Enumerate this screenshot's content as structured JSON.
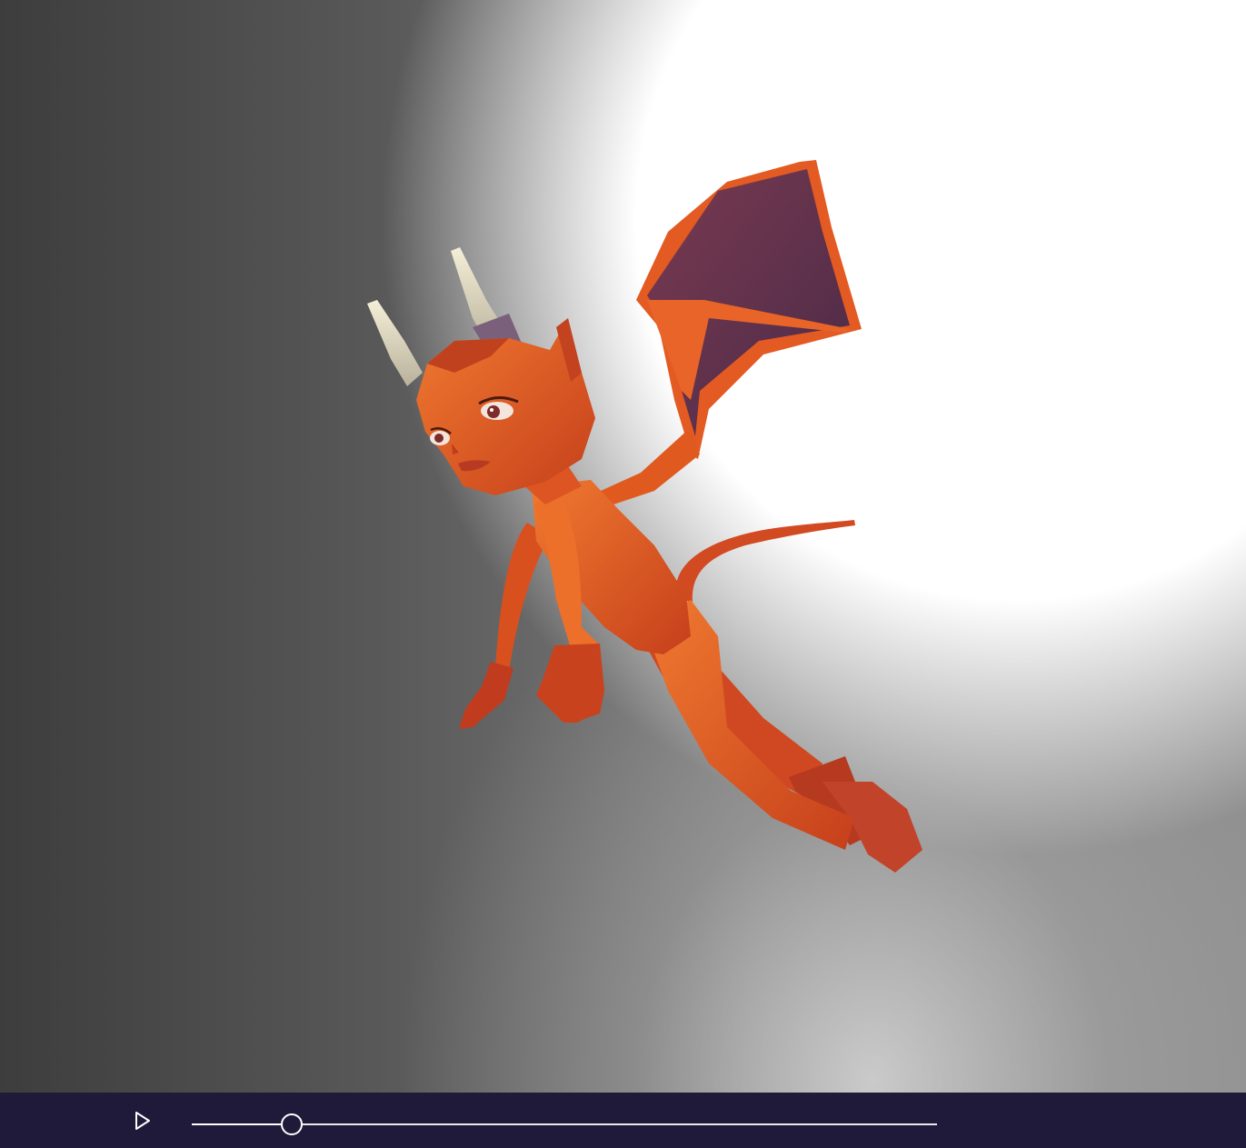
{
  "viewer": {
    "model_name": "red-devil-imp-character"
  },
  "playback": {
    "play_icon": "play-icon",
    "progress": 0.134
  },
  "colors": {
    "control_bar": "#1f1a3a",
    "skin": "#e2561f",
    "wing_membrane": "#5a2a42",
    "horn": "#e9e2c6"
  }
}
